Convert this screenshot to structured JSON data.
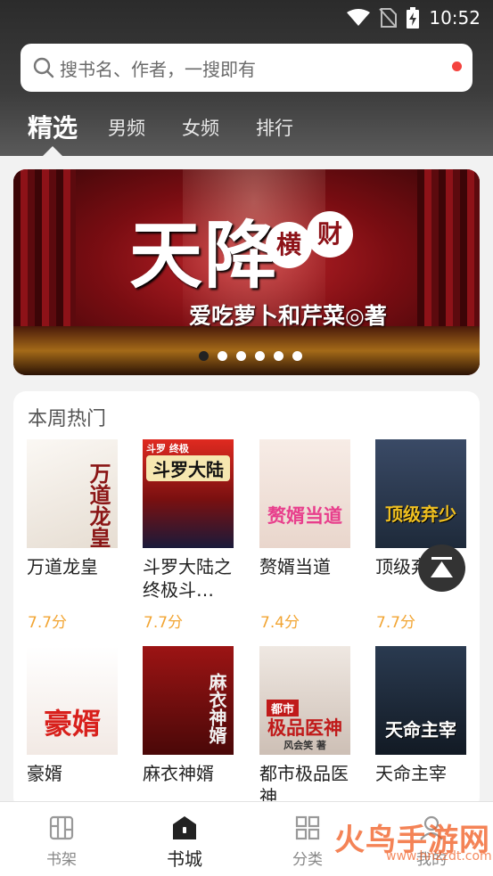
{
  "status_bar": {
    "time": "10:52"
  },
  "search": {
    "placeholder": "搜书名、作者，一搜即有"
  },
  "tabs": [
    {
      "label": "精选",
      "active": true
    },
    {
      "label": "男频"
    },
    {
      "label": "女频"
    },
    {
      "label": "排行"
    }
  ],
  "banner": {
    "title": "天降",
    "title_tag": [
      "横",
      "财"
    ],
    "author": "爱吃萝卜和芹菜◎著",
    "dots": 6,
    "active_dot": 0
  },
  "hot_section": {
    "title": "本周热门",
    "books": [
      {
        "name": "万道龙皇",
        "score": "7.7分",
        "cover_text": "万道龙皇",
        "cover_colors": [
          "#f4f0ea",
          "#8a1515"
        ]
      },
      {
        "name": "斗罗大陆之终极斗…",
        "score": "7.7分",
        "cover_text": "斗罗大陆",
        "cover_top": "斗罗 终极",
        "cover_colors": [
          "#d02020",
          "#1a1a3a"
        ]
      },
      {
        "name": "赘婿当道",
        "score": "7.4分",
        "cover_text": "赘婿当道",
        "cover_colors": [
          "#f6e8e2",
          "#e83e8c"
        ]
      },
      {
        "name": "顶级弃少",
        "score": "7.7分",
        "cover_text": "顶级弃少",
        "cover_colors": [
          "#2c3e55",
          "#f0c020"
        ]
      },
      {
        "name": "豪婿",
        "score": "",
        "cover_text": "豪婿",
        "cover_colors": [
          "#faf6f2",
          "#d8201c"
        ]
      },
      {
        "name": "麻衣神婿",
        "score": "",
        "cover_text": "麻衣神婿",
        "cover_colors": [
          "#8a1010",
          "#f2f2f2"
        ]
      },
      {
        "name": "都市极品医神",
        "score": "",
        "cover_text": "极品医神",
        "cover_top": "都市",
        "cover_sub": "风会笑 著",
        "cover_colors": [
          "#eae4de",
          "#c01a1a"
        ]
      },
      {
        "name": "天命主宰",
        "score": "",
        "cover_text": "天命主宰",
        "cover_colors": [
          "#1e2a3a",
          "#ffffff"
        ]
      }
    ]
  },
  "bottom_nav": [
    {
      "label": "书架",
      "icon": "bookshelf-icon"
    },
    {
      "label": "书城",
      "icon": "store-icon",
      "active": true
    },
    {
      "label": "分类",
      "icon": "category-icon"
    },
    {
      "label": "我的",
      "icon": "profile-icon"
    }
  ],
  "watermark": {
    "text": "火鸟手游网",
    "url": "www.hnzzdt.com"
  },
  "colors": {
    "accent_score": "#f2a533",
    "red_dot": "#f4433e"
  }
}
